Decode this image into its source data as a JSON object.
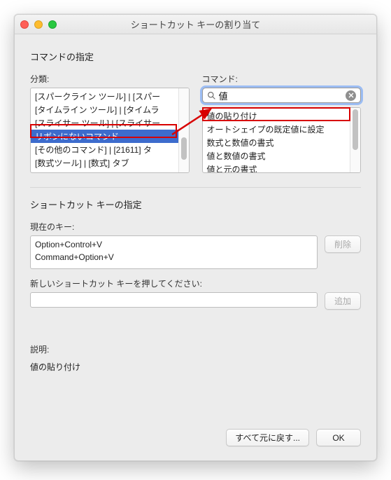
{
  "window": {
    "title": "ショートカット キーの割り当て"
  },
  "section1": {
    "heading": "コマンドの指定",
    "category_label": "分類:",
    "command_label": "コマンド:",
    "category_items": [
      "[スパークライン ツール] | [スパー",
      "[タイムライン ツール] | [タイムラ",
      "[スライサー ツール] | [スライサー",
      "リボンにないコマンド",
      "[その他のコマンド] | [21611] タ",
      "[数式ツール] | [数式] タブ"
    ],
    "category_selected_index": 3,
    "search_value": "値",
    "command_items": [
      "値の貼り付け",
      "オートシェイプの既定値に設定",
      "数式と数値の書式",
      "値と数値の書式",
      "値と元の書式"
    ]
  },
  "section2": {
    "heading": "ショートカット キーの指定",
    "current_label": "現在のキー:",
    "current_keys": [
      "Option+Control+V",
      "Command+Option+V"
    ],
    "delete_btn": "削除",
    "press_label": "新しいショートカット キーを押してください:",
    "press_value": "",
    "add_btn": "追加",
    "desc_label": "説明:",
    "desc_value": "値の貼り付け"
  },
  "footer": {
    "reset_btn": "すべて元に戻す...",
    "ok_btn": "OK"
  }
}
